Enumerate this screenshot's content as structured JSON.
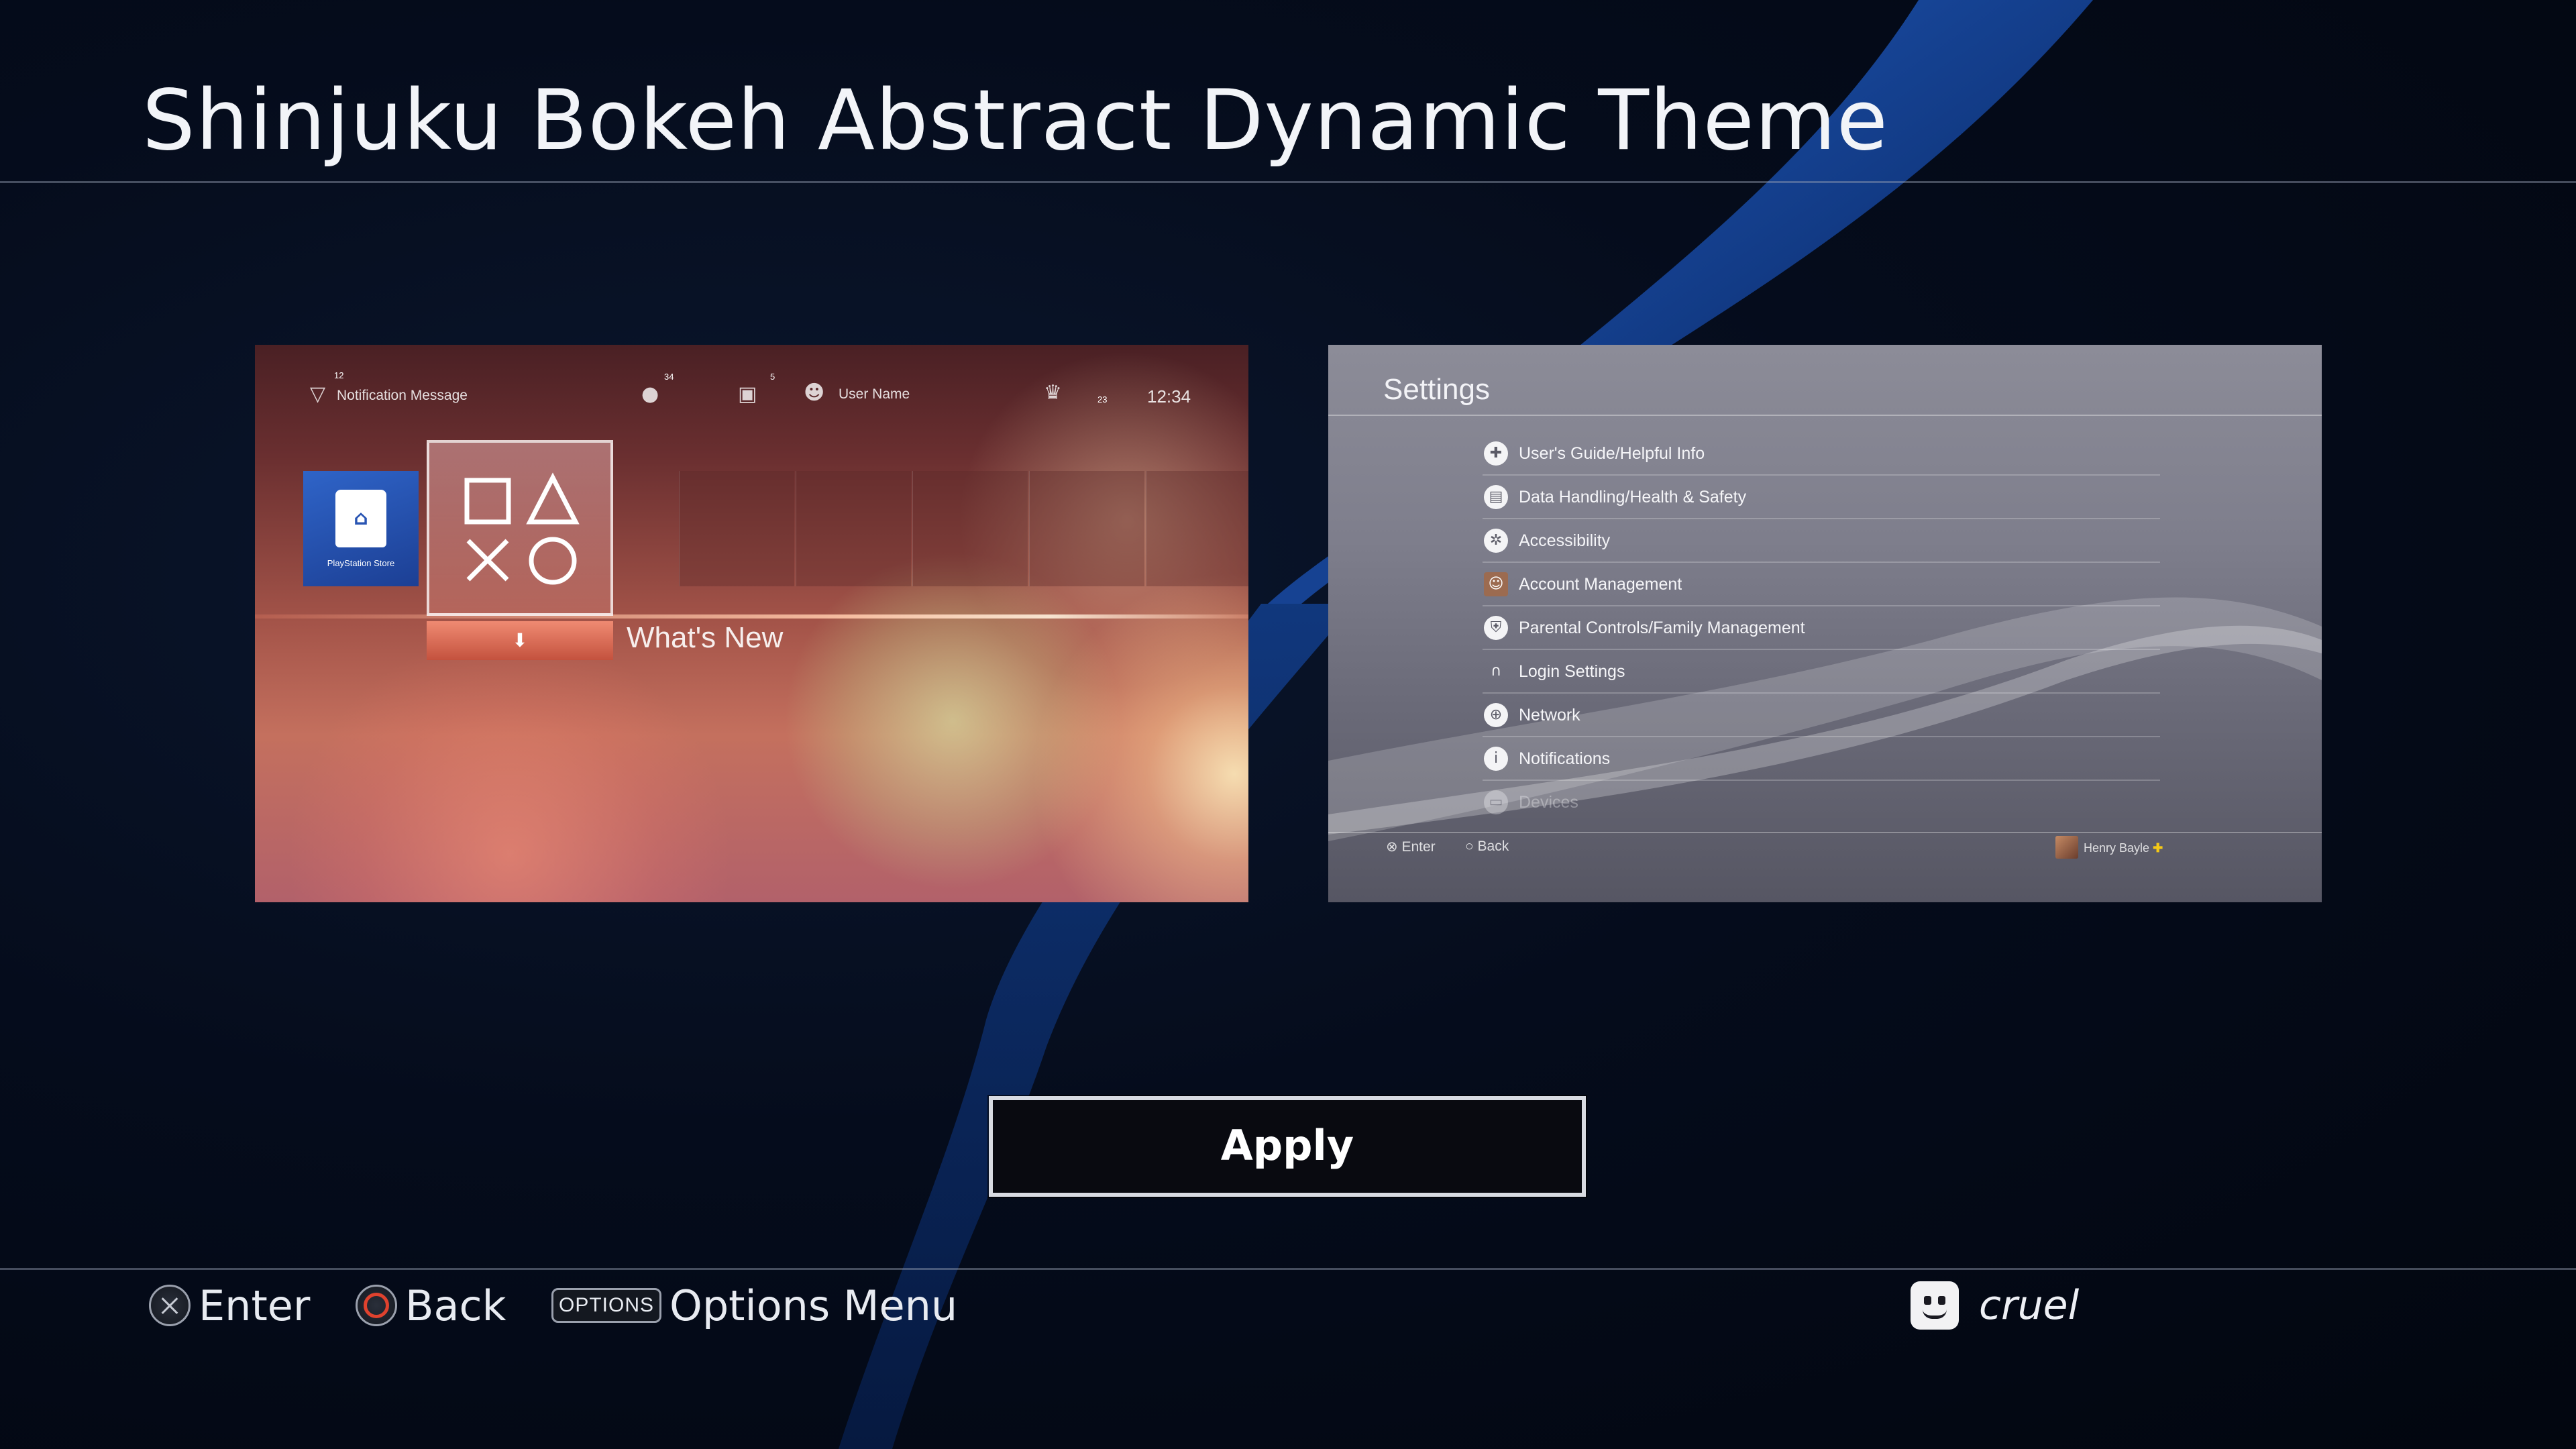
{
  "theme": {
    "title": "Shinjuku Bokeh Abstract Dynamic Theme",
    "accent_color": "#1c4fa8"
  },
  "home_preview": {
    "notification_count": "12",
    "notification_text": "Notification Message",
    "friends_count": "34",
    "messages_count": "5",
    "user_name_label": "User Name",
    "trophy_level": "23",
    "clock": "12:34",
    "store_label": "PlayStation Store",
    "selected_label": "What's New"
  },
  "settings_preview": {
    "title": "Settings",
    "items": [
      {
        "label": "User's Guide/Helpful Info",
        "icon": "help-icon"
      },
      {
        "label": "Data Handling/Health & Safety",
        "icon": "data-icon"
      },
      {
        "label": "Accessibility",
        "icon": "accessibility-icon"
      },
      {
        "label": "Account Management",
        "icon": "account-icon"
      },
      {
        "label": "Parental Controls/Family Management",
        "icon": "parental-icon"
      },
      {
        "label": "Login Settings",
        "icon": "login-icon"
      },
      {
        "label": "Network",
        "icon": "globe-icon"
      },
      {
        "label": "Notifications",
        "icon": "info-icon"
      },
      {
        "label": "Devices",
        "icon": "devices-icon"
      }
    ],
    "footer_enter": "Enter",
    "footer_back": "Back",
    "footer_user": "Henry Bayle"
  },
  "apply_button": {
    "label": "Apply"
  },
  "footer": {
    "enter_label": "Enter",
    "back_label": "Back",
    "options_button": "OPTIONS",
    "options_label": "Options Menu",
    "user_name": "cruel"
  }
}
